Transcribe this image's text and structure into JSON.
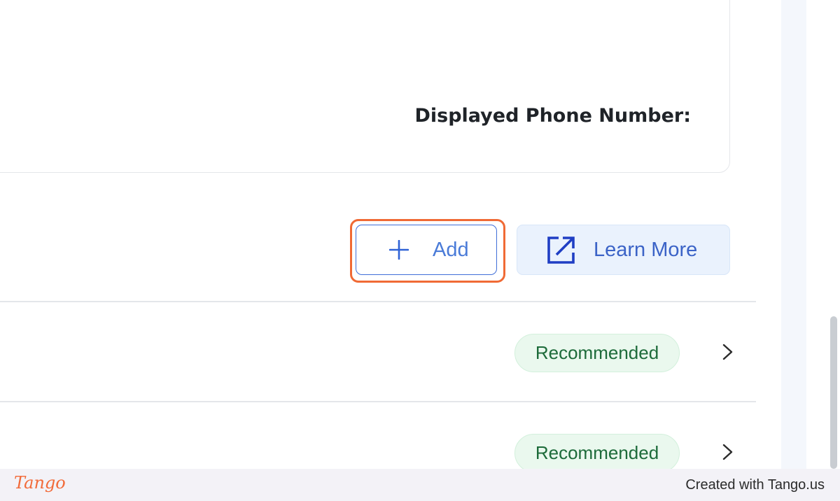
{
  "phone_section": {
    "label": "Displayed Phone Number:"
  },
  "actions": {
    "add_label": "Add",
    "add_icon": "plus-icon",
    "learn_more_label": "Learn More",
    "learn_more_icon": "external-link-icon"
  },
  "rows": [
    {
      "badge": "Recommended",
      "icon": "chevron-right-icon"
    },
    {
      "badge": "Recommended",
      "icon": "chevron-right-icon"
    }
  ],
  "footer": {
    "logo": "Tango",
    "credit": "Created with Tango.us"
  },
  "colors": {
    "accent": "#3f6ed8",
    "highlight": "#f06a35",
    "badge_text": "#1d6b3a",
    "badge_bg": "#eaf8ee"
  }
}
